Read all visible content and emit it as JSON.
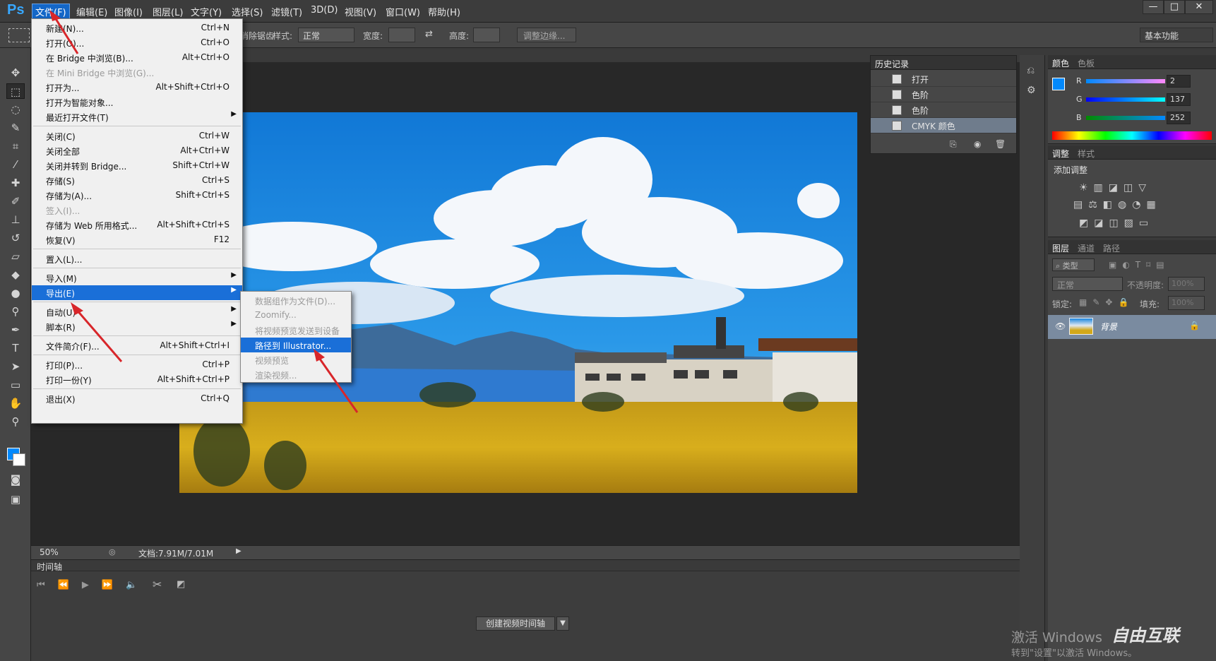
{
  "menubar": {
    "logo": "Ps",
    "items": [
      "文件(F)",
      "编辑(E)",
      "图像(I)",
      "图层(L)",
      "文字(Y)",
      "选择(S)",
      "滤镜(T)",
      "3D(D)",
      "视图(V)",
      "窗口(W)",
      "帮助(H)"
    ],
    "window_buttons": [
      "—",
      "□",
      "✕"
    ]
  },
  "options": {
    "label_partial": "消除锯齿",
    "style_label": "样式:",
    "style_value": "正常",
    "width_label": "宽度:",
    "height_label": "高度:",
    "refine_button": "调整边缘...",
    "workspace": "基本功能"
  },
  "file_menu": {
    "items": [
      {
        "label": "新建(N)...",
        "shortcut": "Ctrl+N"
      },
      {
        "label": "打开(O)...",
        "shortcut": "Ctrl+O"
      },
      {
        "label": "在 Bridge 中浏览(B)...",
        "shortcut": "Alt+Ctrl+O"
      },
      {
        "label": "在 Mini Bridge 中浏览(G)...",
        "shortcut": ""
      },
      {
        "label": "打开为...",
        "shortcut": "Alt+Shift+Ctrl+O"
      },
      {
        "label": "打开为智能对象...",
        "shortcut": ""
      },
      {
        "label": "最近打开文件(T)",
        "shortcut": ""
      },
      {
        "label": "关闭(C)",
        "shortcut": "Ctrl+W"
      },
      {
        "label": "关闭全部",
        "shortcut": "Alt+Ctrl+W"
      },
      {
        "label": "关闭并转到 Bridge...",
        "shortcut": "Shift+Ctrl+W"
      },
      {
        "label": "存储(S)",
        "shortcut": "Ctrl+S"
      },
      {
        "label": "存储为(A)...",
        "shortcut": "Shift+Ctrl+S"
      },
      {
        "label": "签入(I)...",
        "shortcut": ""
      },
      {
        "label": "存储为 Web 所用格式...",
        "shortcut": "Alt+Shift+Ctrl+S"
      },
      {
        "label": "恢复(V)",
        "shortcut": "F12"
      },
      {
        "label": "置入(L)...",
        "shortcut": ""
      },
      {
        "label": "导入(M)",
        "shortcut": ""
      },
      {
        "label": "导出(E)",
        "shortcut": ""
      },
      {
        "label": "自动(U)",
        "shortcut": ""
      },
      {
        "label": "脚本(R)",
        "shortcut": ""
      },
      {
        "label": "文件简介(F)...",
        "shortcut": "Alt+Shift+Ctrl+I"
      },
      {
        "label": "打印(P)...",
        "shortcut": "Ctrl+P"
      },
      {
        "label": "打印一份(Y)",
        "shortcut": "Alt+Shift+Ctrl+P"
      },
      {
        "label": "退出(X)",
        "shortcut": "Ctrl+Q"
      }
    ]
  },
  "export_submenu": {
    "items": [
      "数据组作为文件(D)...",
      "Zoomify...",
      "将视频预览发送到设备",
      "路径到 Illustrator...",
      "视频预览",
      "渲染视频..."
    ]
  },
  "history": {
    "title": "历史记录",
    "rows": [
      "打开",
      "色阶",
      "色阶",
      "CMYK 颜色"
    ]
  },
  "color_panel": {
    "tabs": [
      "颜色",
      "色板"
    ],
    "r_label": "R",
    "g_label": "G",
    "b_label": "B",
    "r_value": "2",
    "g_value": "137",
    "b_value": "252",
    "fg_color": "#0289fc"
  },
  "adjust_panel": {
    "tabs": [
      "调整",
      "样式"
    ],
    "title": "添加调整"
  },
  "layers_panel": {
    "tabs": [
      "图层",
      "通道",
      "路径"
    ],
    "filter_label": "类型",
    "blend_mode": "正常",
    "opacity_label": "不透明度:",
    "opacity_value": "100%",
    "lock_label": "锁定:",
    "fill_label": "填充:",
    "fill_value": "100%",
    "layer_name": "背景"
  },
  "status": {
    "zoom": "50%",
    "doc": "文档:7.91M/7.01M"
  },
  "timeline": {
    "title": "时间轴",
    "create_button": "创建视频时间轴"
  },
  "watermark": {
    "line1": "激活 Windows",
    "line2": "转到\"设置\"以激活 Windows。",
    "brand": "自由互联"
  }
}
